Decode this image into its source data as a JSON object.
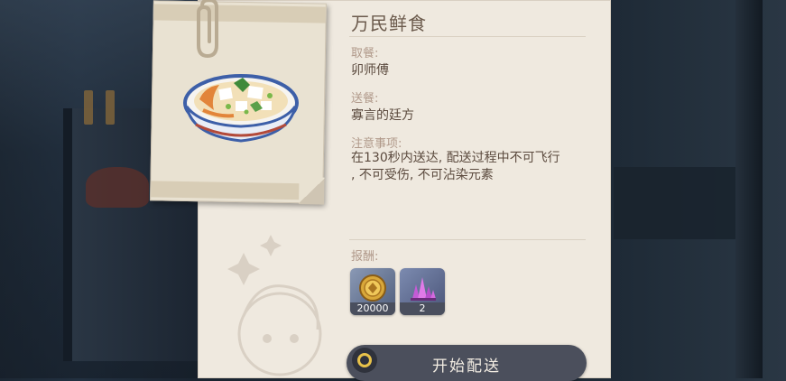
{
  "order": {
    "title": "万民鲜食",
    "pickup_label": "取餐:",
    "pickup_value": "卯师傅",
    "delivery_label": "送餐:",
    "delivery_value": "寡言的廷方",
    "notes_label": "注意事项:",
    "notes_line1": "在130秒内送达, 配送过程中不可飞行",
    "notes_line2": ", 不可受伤, 不可沾染元素"
  },
  "rewards": {
    "label": "报酬:",
    "items": [
      {
        "icon": "mora-coin-icon",
        "count": "20000"
      },
      {
        "icon": "crystal-icon",
        "count": "2"
      }
    ]
  },
  "start_button": {
    "label": "开始配送",
    "icon": "controller-button-icon"
  },
  "colors": {
    "panel": "#efe9df",
    "accent_gold": "#e8c24a",
    "button": "#4b4f5c"
  }
}
